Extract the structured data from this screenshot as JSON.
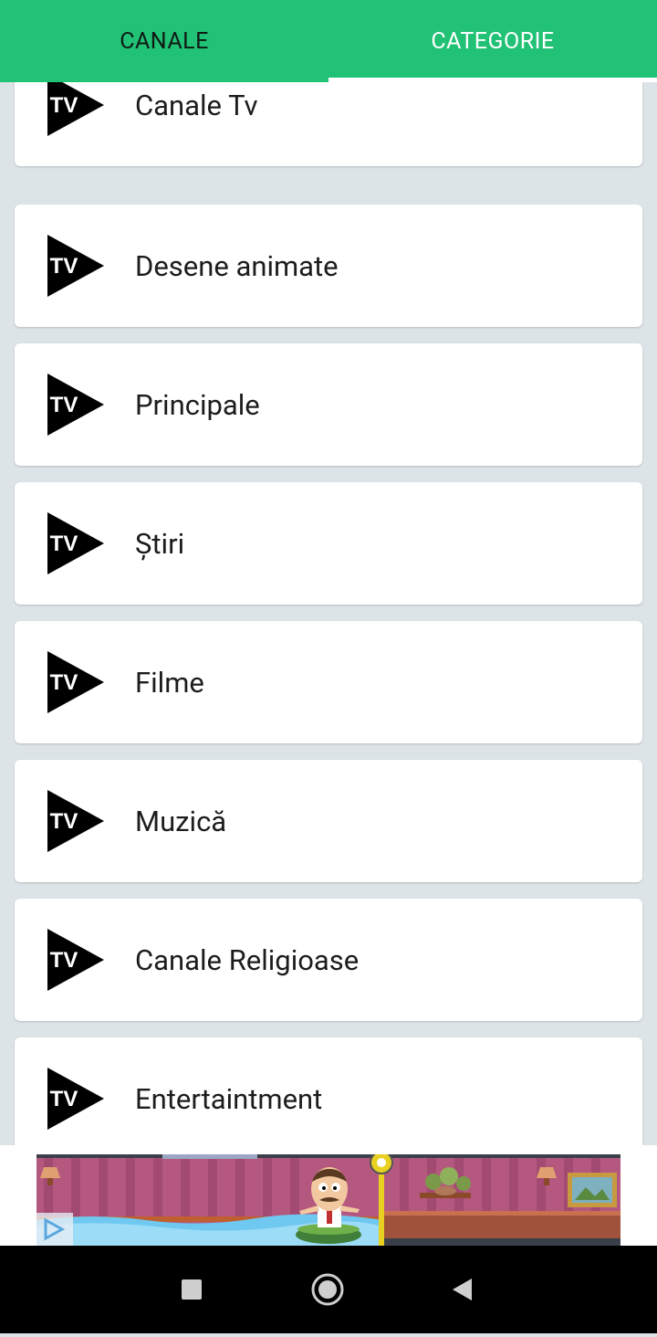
{
  "tabs": [
    {
      "label": "CANALE",
      "active": false
    },
    {
      "label": "CATEGORIE",
      "active": true
    }
  ],
  "categories": [
    {
      "label": "Canale Tv",
      "icon": "tv-play-icon"
    },
    {
      "label": "Desene animate",
      "icon": "tv-play-icon"
    },
    {
      "label": "Principale",
      "icon": "tv-play-icon"
    },
    {
      "label": "Știri",
      "icon": "tv-play-icon"
    },
    {
      "label": "Filme",
      "icon": "tv-play-icon"
    },
    {
      "label": "Muzică",
      "icon": "tv-play-icon"
    },
    {
      "label": "Canale Religioase",
      "icon": "tv-play-icon"
    },
    {
      "label": "Entertaintment",
      "icon": "tv-play-icon"
    }
  ],
  "icon_text": "TV",
  "ad": {
    "icon": "adchoices-icon"
  },
  "navbar": {
    "buttons": [
      "recents-square-icon",
      "home-circle-icon",
      "back-triangle-icon"
    ]
  },
  "colors": {
    "accent": "#21c275",
    "background": "#dde4e8",
    "card": "#ffffff"
  }
}
